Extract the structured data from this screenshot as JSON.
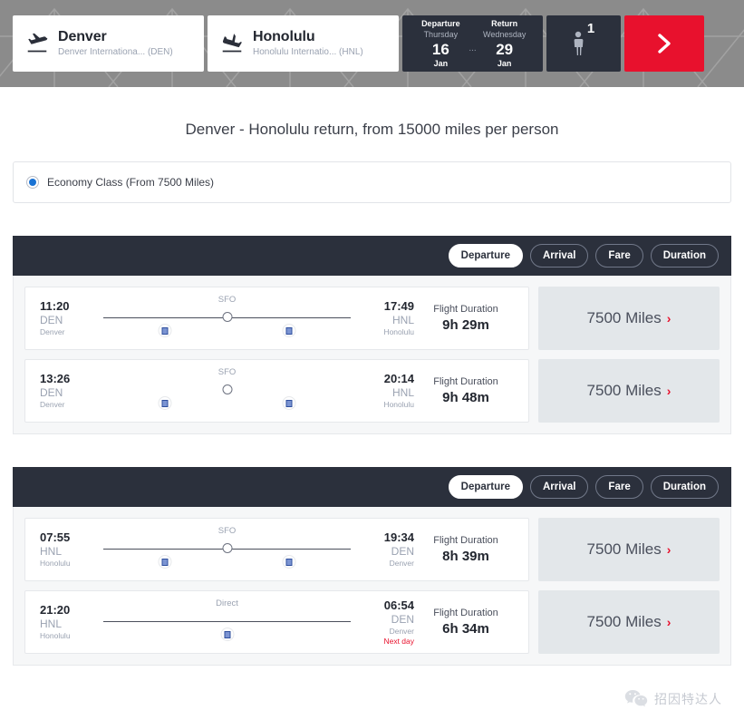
{
  "searchbar": {
    "origin": {
      "icon": "plane-takeoff-icon",
      "city": "Denver",
      "airport": "Denver Internationa... (DEN)"
    },
    "destination": {
      "icon": "plane-landing-icon",
      "city": "Honolulu",
      "airport": "Honolulu Internatio... (HNL)"
    },
    "departure": {
      "label": "Departure",
      "weekday": "Thursday",
      "day": "16",
      "month": "Jan"
    },
    "return": {
      "label": "Return",
      "weekday": "Wednesday",
      "day": "29",
      "month": "Jan"
    },
    "date_separator": "...",
    "passengers": {
      "icon": "passenger-icon",
      "count": "1"
    },
    "submit": {
      "icon": "chevron-right-icon"
    },
    "colors": {
      "panel": "#2b303c",
      "accent": "#e8112d",
      "background": "#8b8b8b"
    }
  },
  "page_title": "Denver - Honolulu return, from 15000 miles per person",
  "cabin_class": {
    "selected": true,
    "label": "Economy Class (From 7500 Miles)",
    "radio_color": "#1a73d4"
  },
  "sort_tabs": [
    {
      "label": "Departure",
      "active": true
    },
    {
      "label": "Arrival",
      "active": false
    },
    {
      "label": "Fare",
      "active": false
    },
    {
      "label": "Duration",
      "active": false
    }
  ],
  "outbound": {
    "flights": [
      {
        "depart_time": "11:20",
        "depart_code": "DEN",
        "depart_city": "Denver",
        "arrive_time": "17:49",
        "arrive_code": "HNL",
        "arrive_city": "Honolulu",
        "arrive_nextday": "",
        "stop_label": "SFO",
        "has_line": true,
        "stop_marker": true,
        "leg_logo_positions": [
          25,
          75
        ],
        "duration_label": "Flight Duration",
        "duration_value": "9h 29m",
        "fare": "7500 Miles",
        "fare_chevron": "›"
      },
      {
        "depart_time": "13:26",
        "depart_code": "DEN",
        "depart_city": "Denver",
        "arrive_time": "20:14",
        "arrive_code": "HNL",
        "arrive_city": "Honolulu",
        "arrive_nextday": "",
        "stop_label": "SFO",
        "has_line": false,
        "stop_marker": true,
        "leg_logo_positions": [
          25,
          75
        ],
        "duration_label": "Flight Duration",
        "duration_value": "9h 48m",
        "fare": "7500 Miles",
        "fare_chevron": "›"
      }
    ]
  },
  "inbound": {
    "flights": [
      {
        "depart_time": "07:55",
        "depart_code": "HNL",
        "depart_city": "Honolulu",
        "arrive_time": "19:34",
        "arrive_code": "DEN",
        "arrive_city": "Denver",
        "arrive_nextday": "",
        "stop_label": "SFO",
        "has_line": true,
        "stop_marker": true,
        "leg_logo_positions": [
          25,
          75
        ],
        "duration_label": "Flight Duration",
        "duration_value": "8h 39m",
        "fare": "7500 Miles",
        "fare_chevron": "›"
      },
      {
        "depart_time": "21:20",
        "depart_code": "HNL",
        "depart_city": "Honolulu",
        "arrive_time": "06:54",
        "arrive_code": "DEN",
        "arrive_city": "Denver",
        "arrive_nextday": "Next day",
        "stop_label": "Direct",
        "has_line": true,
        "stop_marker": false,
        "leg_logo_positions": [
          50
        ],
        "duration_label": "Flight Duration",
        "duration_value": "6h 34m",
        "fare": "7500 Miles",
        "fare_chevron": "›"
      }
    ]
  },
  "watermark": {
    "icon": "wechat-icon",
    "text": "招因特达人"
  }
}
